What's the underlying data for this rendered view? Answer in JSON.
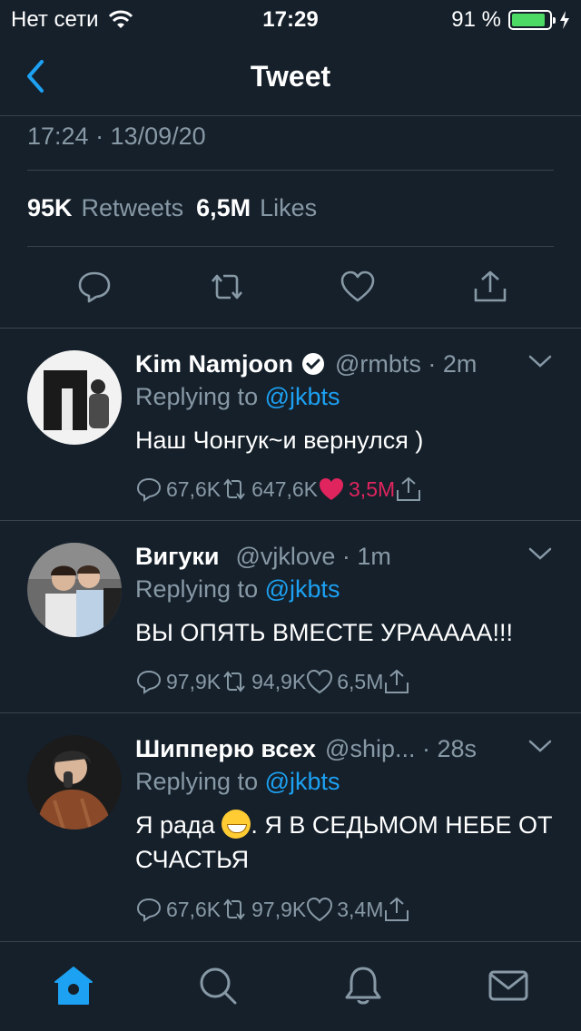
{
  "status_bar": {
    "carrier": "Нет сети",
    "time": "17:29",
    "battery_percent": "91 %",
    "battery_level": 0.91,
    "icons": [
      "wifi-icon",
      "battery-icon",
      "charging-bolt-icon"
    ]
  },
  "header": {
    "title": "Tweet",
    "back_icon": "chevron-left-icon"
  },
  "tweet_detail": {
    "timestamp": "17:24 · 13/09/20",
    "retweets_count": "95K",
    "retweets_label": "Retweets",
    "likes_count": "6,5M",
    "likes_label": "Likes",
    "action_icons": [
      "reply-icon",
      "retweet-icon",
      "like-icon",
      "share-icon"
    ]
  },
  "replies": [
    {
      "name": "Kim Namjoon",
      "verified": true,
      "handle_time": "@rmbts · 2m",
      "replying_prefix": "Replying to",
      "replying_to": "@jkbts",
      "text": "Наш Чонгук~и вернулся )",
      "replies": "67,6K",
      "retweets": "647,6K",
      "likes": "3,5M",
      "liked": true
    },
    {
      "name": "Вигуки",
      "verified": false,
      "handle_time": "@vjklove · 1m",
      "replying_prefix": "Replying to",
      "replying_to": "@jkbts",
      "text": "ВЫ ОПЯТЬ ВМЕСТЕ УРААААА!!!",
      "replies": "97,9K",
      "retweets": "94,9K",
      "likes": "6,5M",
      "liked": false
    },
    {
      "name": "Шипперю всех",
      "verified": false,
      "handle_time": "@ship... · 28s",
      "replying_prefix": "Replying to",
      "replying_to": "@jkbts",
      "text_before_emoji": "Я рада",
      "emoji": "grinning-face-icon",
      "text_after_emoji": ". Я В СЕДЬМОМ НЕБЕ ОТ СЧАСТЬЯ",
      "replies": "67,6K",
      "retweets": "97,9K",
      "likes": "3,4M",
      "liked": false
    }
  ],
  "tab_bar": {
    "tabs": [
      "home-icon",
      "search-icon",
      "notifications-bell-icon",
      "messages-envelope-icon"
    ],
    "active_tab": "home-icon"
  },
  "colors": {
    "background": "#15202b",
    "divider": "#38444d",
    "accent": "#1da1f2",
    "muted": "#8899a6",
    "like": "#e0245e",
    "battery": "#4cd964"
  }
}
